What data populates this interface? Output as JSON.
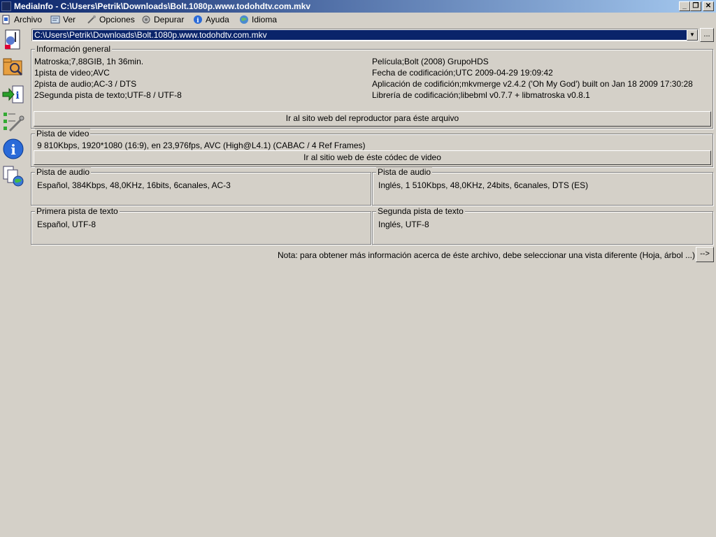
{
  "window": {
    "title": "MediaInfo - C:\\Users\\Petrik\\Downloads\\Bolt.1080p.www.todohdtv.com.mkv",
    "minimize": "_",
    "restore": "❐",
    "close": "✕"
  },
  "menu": [
    {
      "label": "Archivo",
      "icon": "file-icon"
    },
    {
      "label": "Ver",
      "icon": "view-icon"
    },
    {
      "label": "Opciones",
      "icon": "options-icon"
    },
    {
      "label": "Depurar",
      "icon": "debug-icon"
    },
    {
      "label": "Ayuda",
      "icon": "help-icon"
    },
    {
      "label": "Idioma",
      "icon": "language-icon"
    }
  ],
  "sidebar": [
    "open-file-icon",
    "open-folder-icon",
    "export-icon",
    "preferences-icon",
    "about-icon",
    "web-icon"
  ],
  "path": {
    "value": "C:\\Users\\Petrik\\Downloads\\Bolt.1080p.www.todohdtv.com.mkv",
    "dropdown_glyph": "▼",
    "browse_label": "..."
  },
  "general": {
    "legend": "Información general",
    "left": [
      "Matroska;7,88GIB, 1h 36min.",
      "1pista de video;AVC",
      "2pista de audio;AC-3 / DTS",
      "2Segunda pista de texto;UTF-8 / UTF-8"
    ],
    "right": [
      "Película;Bolt (2008) GrupoHDS",
      "Fecha de codificación;UTC 2009-04-29 19:09:42",
      "Aplicación de codifición;mkvmerge v2.4.2 ('Oh My God') built on Jan 18 2009 17:30:28",
      "Librería de codificación;libebml v0.7.7 + libmatroska v0.8.1"
    ],
    "button": "Ir al sito web del reproductor para éste arquivo"
  },
  "video": {
    "legend": "Pista de video",
    "text": "9 810Kbps, 1920*1080 (16:9), en 23,976fps, AVC (High@L4.1) (CABAC / 4 Ref Frames)",
    "button": "Ir al sitio web de éste códec de video"
  },
  "audio1": {
    "legend": "Pista de audio",
    "text": "Español, 384Kbps, 48,0KHz, 16bits, 6canales, AC-3"
  },
  "audio2": {
    "legend": "Pista de audio",
    "text": "Inglés, 1 510Kbps, 48,0KHz, 24bits, 6canales, DTS (ES)"
  },
  "text1": {
    "legend": "Primera pista de texto",
    "text": "Español, UTF-8"
  },
  "text2": {
    "legend": "Segunda pista de texto",
    "text": "Inglés, UTF-8"
  },
  "note": "Nota: para obtener más información acerca de éste archivo, debe seleccionar una vista diferente (Hoja, árbol ...)",
  "next_button": "-->"
}
